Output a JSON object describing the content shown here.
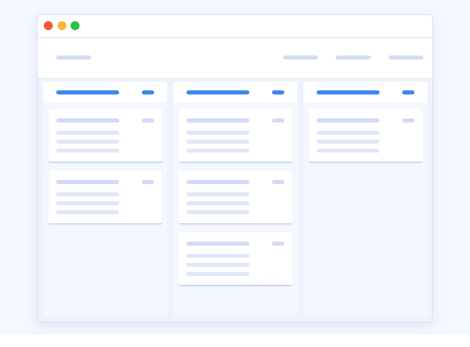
{
  "window": {
    "traffic_lights": {
      "close_color": "#f0592b",
      "minimize_color": "#f7b731",
      "maximize_color": "#2bc23e"
    },
    "accent_color": "#3b87ee",
    "skeleton_color": "#d1daf6"
  },
  "navbar": {
    "items": [
      "nav-logo",
      "nav-link-1",
      "nav-link-2",
      "nav-link-3"
    ]
  },
  "board": {
    "columns": [
      {
        "name": "column-1",
        "card_count": 2
      },
      {
        "name": "column-2",
        "card_count": 3
      },
      {
        "name": "column-3",
        "card_count": 1
      }
    ]
  }
}
